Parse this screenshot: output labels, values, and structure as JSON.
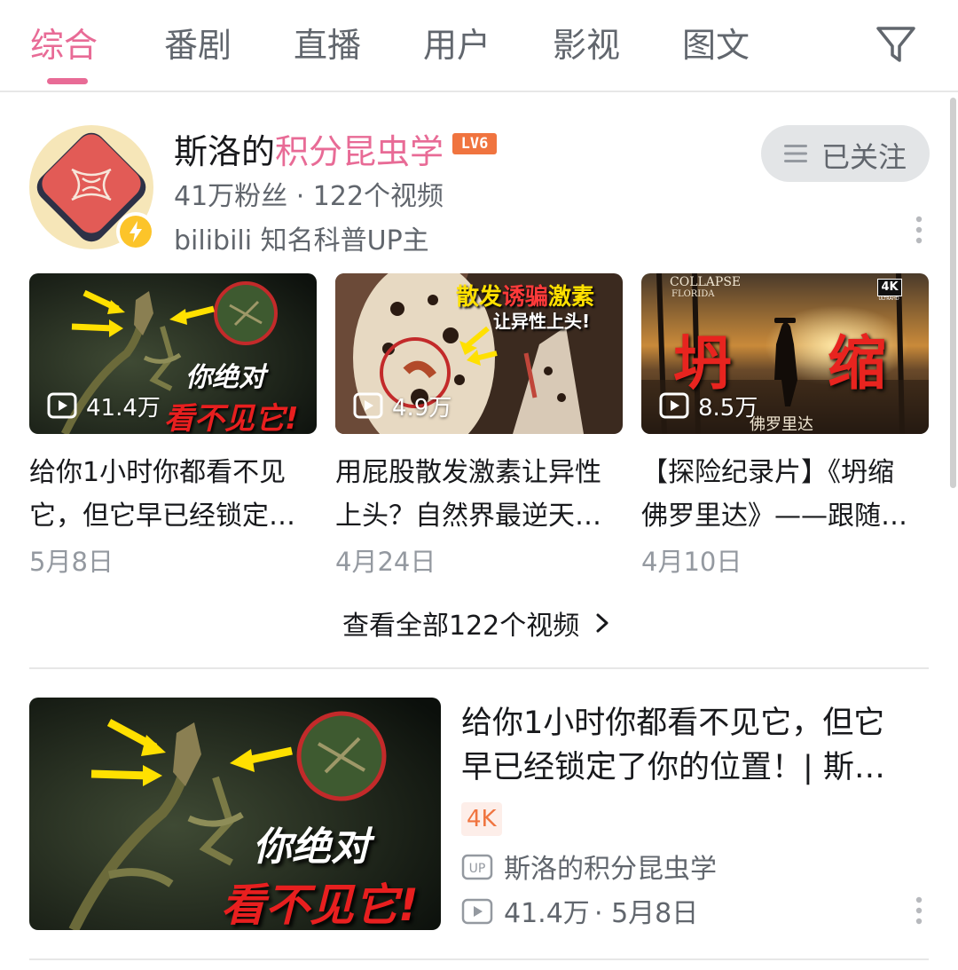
{
  "tabs": [
    {
      "label": "综合",
      "active": true
    },
    {
      "label": "番剧"
    },
    {
      "label": "直播"
    },
    {
      "label": "用户"
    },
    {
      "label": "影视"
    },
    {
      "label": "图文"
    }
  ],
  "accent_color": "#e86b96",
  "up": {
    "name_prefix": "斯洛的",
    "name_highlight": "积分昆虫学",
    "level": "LV6",
    "stats": "41万粉丝 · 122个视频",
    "certification": "bilibili 知名科普UP主",
    "follow_label": "已关注"
  },
  "videos": [
    {
      "views": "41.4万",
      "title_line1": "给你1小时你都看不见",
      "title_line2": "它，但它早已经锁定…",
      "date": "5月8日",
      "thumb_text1": "你绝对",
      "thumb_text2": "看不见它!"
    },
    {
      "views": "4.9万",
      "title_line1": "用屁股散发激素让异性",
      "title_line2": "上头？自然界最逆天…",
      "date": "4月24日",
      "thumb_text1_a": "散发",
      "thumb_text1_b": "诱骗",
      "thumb_text1_c": "激素",
      "thumb_text2": "让异性上头!"
    },
    {
      "views": "8.5万",
      "title_line1": "【探险纪录片】《坍缩",
      "title_line2": "佛罗里达》——跟随…",
      "date": "4月10日",
      "thumb_top1": "COLLAPSE",
      "thumb_top2": "FLORIDA",
      "thumb_badge": "4K",
      "thumb_badge_sub": "ULTRAHD",
      "thumb_big_left": "坍",
      "thumb_big_right": "缩",
      "thumb_sub": "佛罗里达"
    }
  ],
  "view_all": "查看全部122个视频",
  "featured": {
    "title_line1": "给你1小时你都看不见它，但它",
    "title_line2": "早已经锁定了你的位置！| 斯…",
    "tag": "4K",
    "author": "斯洛的积分昆虫学",
    "views": "41.4万",
    "date": "· 5月8日",
    "thumb_text1": "你绝对",
    "thumb_text2": "看不见它!"
  },
  "icons": {
    "filter": "filter-icon",
    "follow": "menu-lines-icon",
    "more": "more-vertical-icon",
    "play": "play-count-icon",
    "up": "up-badge-icon",
    "verify": "lightning-verify-icon",
    "chevron": "chevron-right-icon"
  }
}
